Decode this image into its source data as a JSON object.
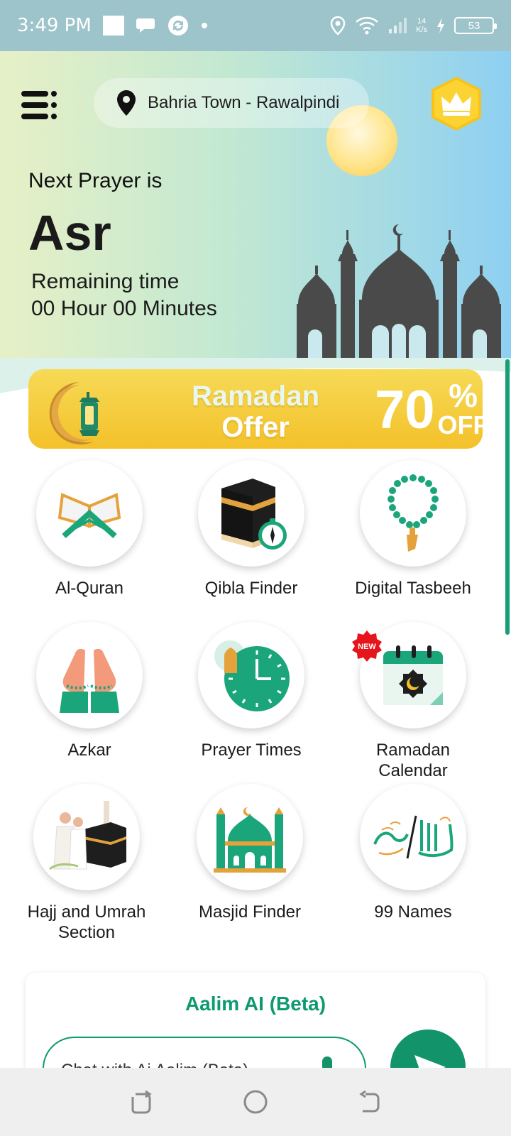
{
  "status_bar": {
    "time": "3:49 PM",
    "speed_top": "14",
    "speed_bottom": "K/s",
    "battery": "53"
  },
  "header": {
    "location": "Bahria Town - Rawalpindi",
    "icons": [
      "menu-icon",
      "location-pin-icon",
      "crown-icon"
    ]
  },
  "prayer": {
    "next_label": "Next Prayer is",
    "name": "Asr",
    "remaining_label": "Remaining time",
    "remaining_value": "00 Hour 00 Minutes"
  },
  "banner": {
    "title_line1": "Ramadan",
    "title_line2": "Offer",
    "discount": "70",
    "percent": "%",
    "off": "OFF"
  },
  "features": [
    {
      "label": "Al-Quran",
      "icon": "quran-icon"
    },
    {
      "label": "Qibla Finder",
      "icon": "kaaba-compass-icon"
    },
    {
      "label": "Digital Tasbeeh",
      "icon": "tasbeeh-icon"
    },
    {
      "label": "Azkar",
      "icon": "praying-hands-icon"
    },
    {
      "label": "Prayer Times",
      "icon": "clock-icon"
    },
    {
      "label": "Ramadan\nCalendar",
      "icon": "calendar-icon",
      "badge": "NEW"
    },
    {
      "label": "Hajj and Umrah\nSection",
      "icon": "hajj-icon"
    },
    {
      "label": "Masjid Finder",
      "icon": "mosque-icon"
    },
    {
      "label": "99 Names",
      "icon": "calligraphy-icon"
    }
  ],
  "ai": {
    "title": "Aalim AI (Beta)",
    "placeholder": "Chat with Ai Aalim (Beta)"
  },
  "colors": {
    "primary": "#13936a",
    "banner": "#f4c12a",
    "status_bar": "#9dc3cb"
  }
}
